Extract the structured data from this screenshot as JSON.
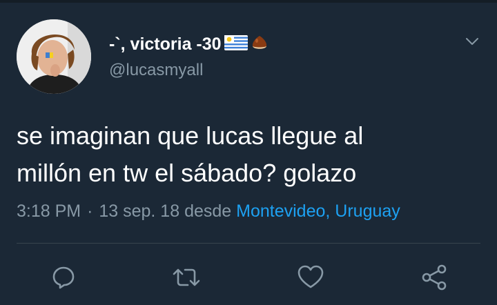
{
  "user": {
    "display_name": "-`, victoria -30",
    "flag_icon": "uruguay-flag-icon",
    "extra_icon": "chestnut-icon",
    "handle": "@lucasmyall"
  },
  "tweet": {
    "text_line1": "se imaginan que lucas llegue al",
    "text_line2": "millón en tw el sábado? golazo",
    "time": "3:18 PM",
    "separator": "·",
    "date": "13 sep. 18",
    "source_prefix": "desde",
    "location": "Montevideo, Uruguay"
  },
  "actions": [
    {
      "icon": "reply-icon"
    },
    {
      "icon": "retweet-icon"
    },
    {
      "icon": "like-icon"
    },
    {
      "icon": "share-icon"
    }
  ],
  "colors": {
    "background": "#1b2836",
    "text": "#ffffff",
    "secondary": "#8899a6",
    "link": "#1da1f2",
    "divider": "#38444d"
  }
}
